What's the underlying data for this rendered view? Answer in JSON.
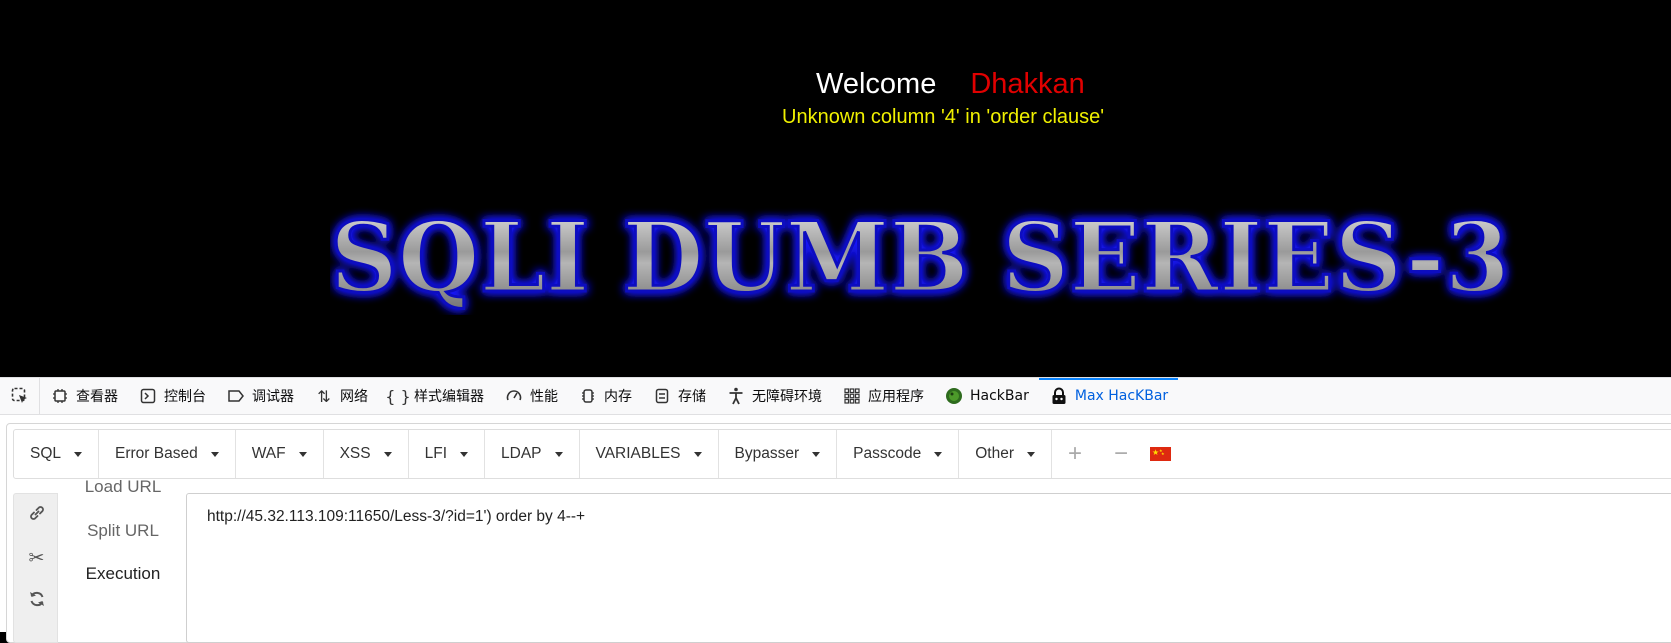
{
  "page": {
    "welcome_word": "Welcome",
    "welcome_name": "Dhakkan",
    "error": "Unknown column '4' in 'order clause'",
    "banner": "SQLI DUMB SERIES-3"
  },
  "devtools": {
    "tabs": [
      {
        "label": "查看器",
        "icon": "inspector-icon"
      },
      {
        "label": "控制台",
        "icon": "console-icon"
      },
      {
        "label": "调试器",
        "icon": "debugger-icon"
      },
      {
        "label": "网络",
        "icon": "network-icon"
      },
      {
        "label": "样式编辑器",
        "icon": "style-editor-icon"
      },
      {
        "label": "性能",
        "icon": "performance-icon"
      },
      {
        "label": "内存",
        "icon": "memory-icon"
      },
      {
        "label": "存储",
        "icon": "storage-icon"
      },
      {
        "label": "无障碍环境",
        "icon": "accessibility-icon"
      },
      {
        "label": "应用程序",
        "icon": "application-icon"
      },
      {
        "label": "HackBar",
        "icon": "hackbar-icon"
      },
      {
        "label": "Max HacKBar",
        "icon": "max-hackbar-icon"
      }
    ],
    "active_tab": "Max HacKBar"
  },
  "hackbar": {
    "menu": [
      "SQL",
      "Error Based",
      "WAF",
      "XSS",
      "LFI",
      "LDAP",
      "VARIABLES",
      "Bypasser",
      "Passcode",
      "Other"
    ],
    "plus": "+",
    "minus": "−",
    "side": {
      "load": "Load URL",
      "split": "Split URL",
      "execute": "Execution"
    },
    "url": "http://45.32.113.109:11650/Less-3/?id=1') order by 4--+"
  },
  "colors": {
    "welcome_name": "#e00000",
    "error": "#f0f000",
    "active_tab": "#0060df",
    "banner_glow": "#1a1aff"
  }
}
